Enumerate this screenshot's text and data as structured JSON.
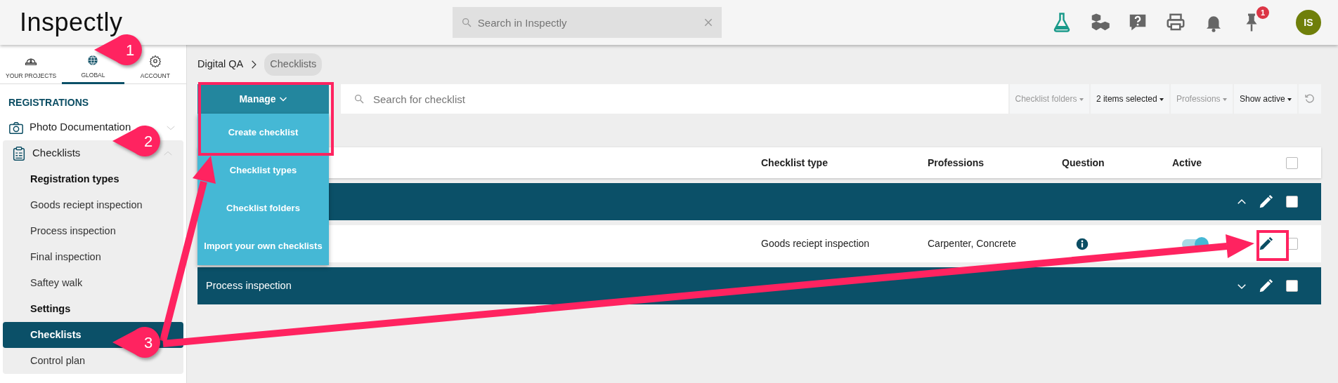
{
  "header": {
    "logo": "Inspectly",
    "search": {
      "placeholder": "Search in Inspectly"
    },
    "notification_badge": "1",
    "avatar": "IS"
  },
  "sidebar": {
    "tabs": [
      {
        "label": "YOUR PROJECTS",
        "selected": false
      },
      {
        "label": "GLOBAL",
        "selected": true
      },
      {
        "label": "ACCOUNT",
        "selected": false
      }
    ],
    "section": "REGISTRATIONS",
    "items": [
      {
        "label": "Photo Documentation",
        "expanded": false
      },
      {
        "label": "Checklists",
        "expanded": true,
        "children": [
          {
            "label": "Registration types",
            "kind": "heading",
            "selected": false
          },
          {
            "label": "Goods reciept inspection",
            "kind": "link",
            "selected": false
          },
          {
            "label": "Process inspection",
            "kind": "link",
            "selected": false
          },
          {
            "label": "Final inspection",
            "kind": "link",
            "selected": false
          },
          {
            "label": "Saftey walk",
            "kind": "link",
            "selected": false
          },
          {
            "label": "Settings",
            "kind": "heading",
            "selected": false
          },
          {
            "label": "Checklists",
            "kind": "link",
            "selected": true
          },
          {
            "label": "Control plan",
            "kind": "link",
            "selected": false
          }
        ]
      }
    ]
  },
  "breadcrumb": [
    "Digital QA",
    "Checklists"
  ],
  "manage": {
    "label": "Manage",
    "menu": [
      "Create checklist",
      "Checklist types",
      "Checklist folders",
      "Import your own checklists"
    ]
  },
  "search": {
    "placeholder": "Search for checklist"
  },
  "filters": [
    {
      "label": "Checklist folders",
      "active": false
    },
    {
      "label": "2 items selected",
      "active": true
    },
    {
      "label": "Professions",
      "active": false
    },
    {
      "label": "Show active",
      "active": true
    }
  ],
  "table": {
    "columns": [
      "Checklist type",
      "Professions",
      "Question",
      "Active"
    ],
    "all_checked": false,
    "rows": [
      {
        "kind": "group",
        "expanded": true,
        "checked": false
      },
      {
        "kind": "item",
        "type": "Goods reciept inspection",
        "professions": "Carpenter, Concrete",
        "active": true,
        "checked": false
      },
      {
        "kind": "group",
        "title": "Process inspection",
        "expanded": false,
        "checked": false
      }
    ]
  },
  "annotations": [
    "1",
    "2",
    "3"
  ]
}
